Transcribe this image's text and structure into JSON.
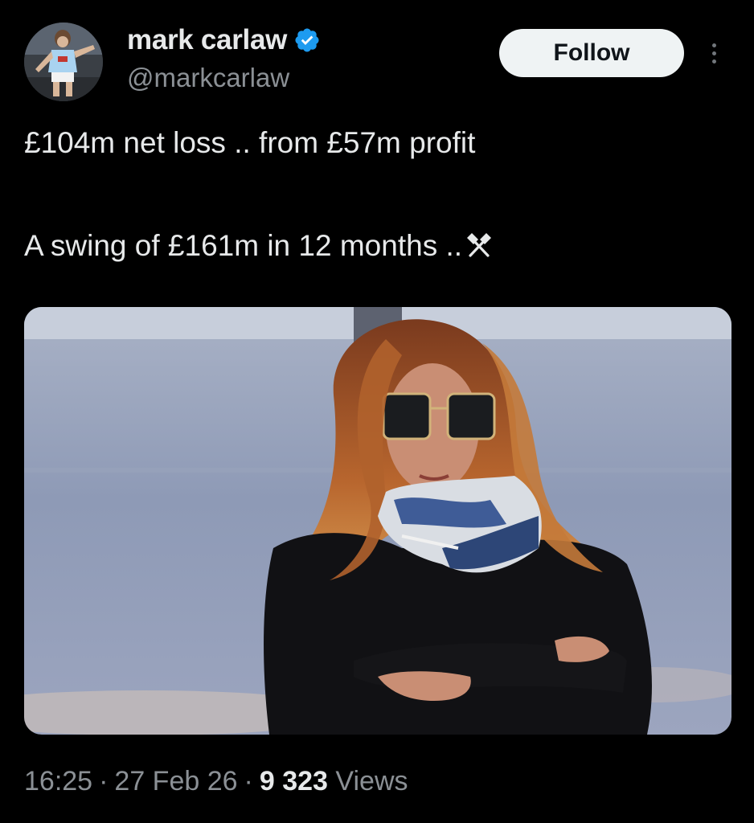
{
  "author": {
    "display_name": "mark carlaw",
    "handle": "@markcarlaw",
    "verified_icon": "verified-badge-icon",
    "accent_color": "#1d9bf0"
  },
  "actions": {
    "follow_label": "Follow",
    "more_icon": "more-vertical-icon"
  },
  "tweet": {
    "line1": "£104m net loss .. from £57m profit",
    "line2": "A swing of £161m in 12 months ..",
    "line2_emoji": "crossed-hammers-icon"
  },
  "media": {
    "description_icon": "photo-woman-sunglasses-scarf"
  },
  "meta": {
    "time": "16:25",
    "separator": "·",
    "date": "27 Feb 26",
    "views_count": "9 323",
    "views_label": "Views"
  }
}
